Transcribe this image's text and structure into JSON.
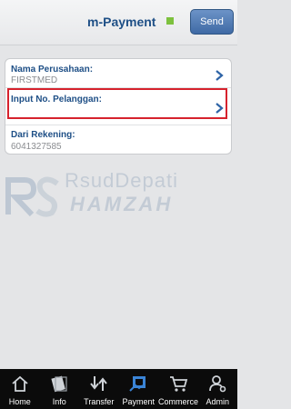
{
  "header": {
    "title": "m-Payment",
    "send_label": "Send",
    "status_color": "#7dc13e"
  },
  "form": {
    "rows": [
      {
        "label": "Nama Perusahaan:",
        "value": "FIRSTMED",
        "icon": "chevron-right-icon"
      },
      {
        "label": "Input No. Pelanggan:",
        "value": "",
        "icon": "chevron-right-icon",
        "highlighted": true
      },
      {
        "label": "Dari Rekening:",
        "value": "6041327585"
      }
    ]
  },
  "watermark": {
    "line1": "RsudDepati",
    "line2": "HAMZAH"
  },
  "nav": {
    "items": [
      {
        "label": "Home",
        "icon": "home-icon"
      },
      {
        "label": "Info",
        "icon": "info-icon"
      },
      {
        "label": "Transfer",
        "icon": "transfer-icon"
      },
      {
        "label": "Payment",
        "icon": "payment-icon"
      },
      {
        "label": "Commerce",
        "icon": "cart-icon"
      },
      {
        "label": "Admin",
        "icon": "admin-icon"
      }
    ]
  },
  "colors": {
    "accent": "#1e4f86",
    "highlight": "#d6222d",
    "nav_bg": "#0b0b0b"
  }
}
